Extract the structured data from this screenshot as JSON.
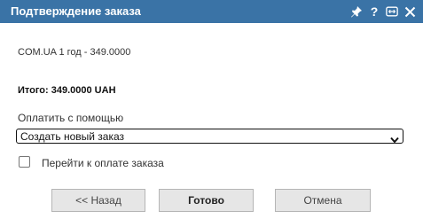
{
  "dialog": {
    "title": "Подтверждение заказа",
    "title_icons": [
      "pin-icon",
      "help-icon",
      "resize-icon",
      "close-icon"
    ],
    "help_glyph": "?"
  },
  "order": {
    "line_item": "COM.UA 1 год - 349.0000",
    "total": "Итого: 349.0000 UAH"
  },
  "payment": {
    "label": "Оплатить с помощью",
    "selected": "Создать новый заказ"
  },
  "checkbox": {
    "label": "Перейти к оплате заказа",
    "checked": false
  },
  "buttons": {
    "back": "<< Назад",
    "done": "Готово",
    "cancel": "Отмена"
  },
  "colors": {
    "titlebar": "#3a73a6",
    "button_bg": "#e6e6e6"
  }
}
